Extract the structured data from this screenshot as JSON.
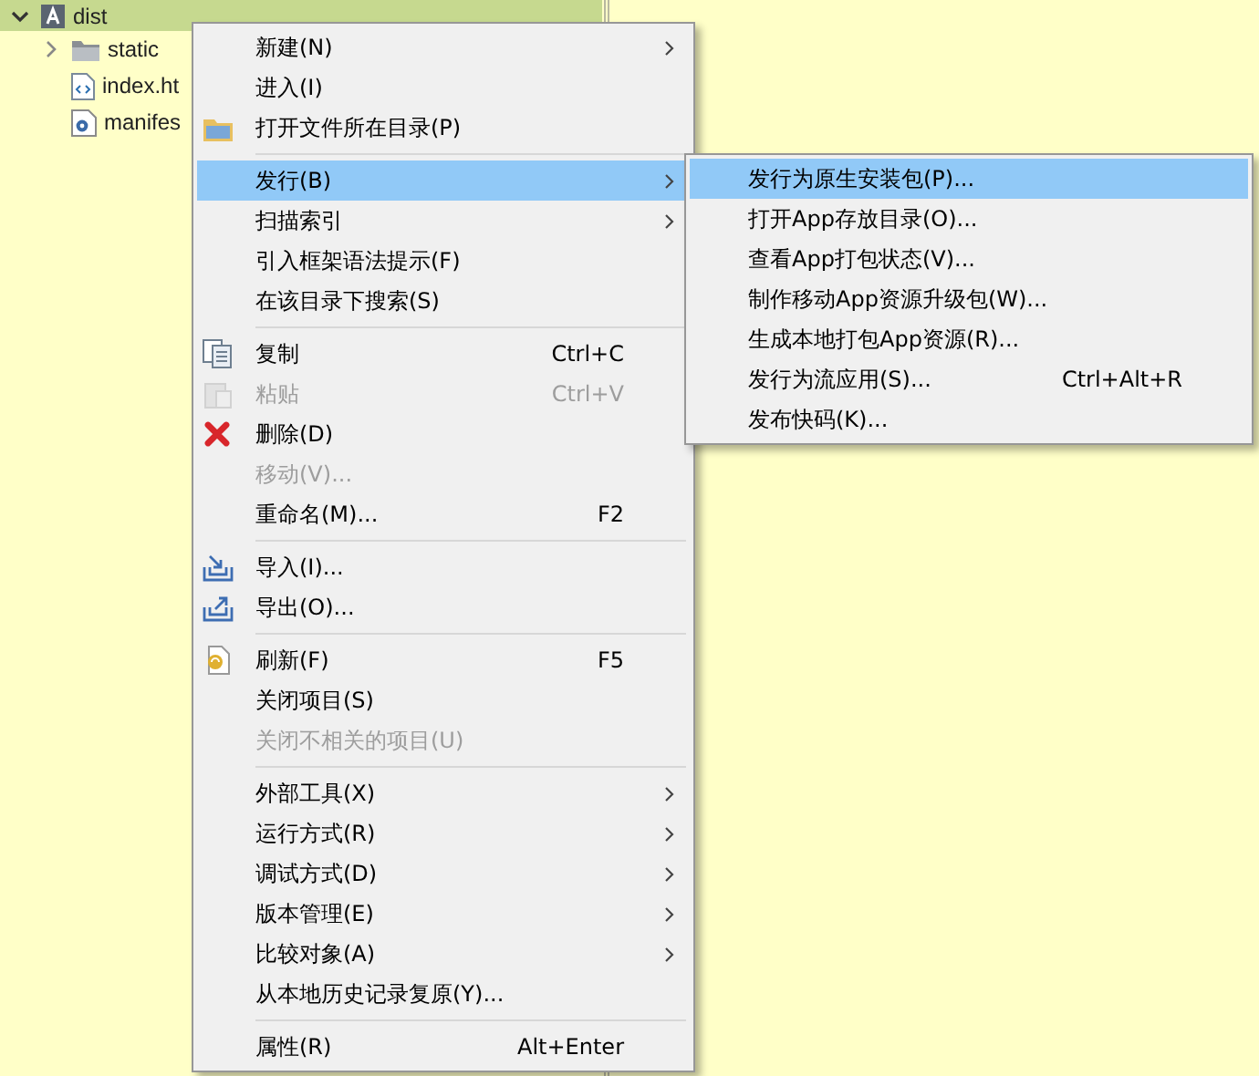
{
  "tree": [
    {
      "label": "dist",
      "kind": "project",
      "selected": true,
      "expanded": true,
      "children": [
        {
          "label": "static",
          "kind": "folder",
          "selected": false,
          "expanded": false
        },
        {
          "label": "index.ht",
          "kind": "html-file",
          "selected": false
        },
        {
          "label": "manifes",
          "kind": "config-file",
          "selected": false
        }
      ]
    }
  ],
  "context_menu": {
    "items": [
      {
        "kind": "item",
        "label": "新建(N)",
        "submenu": true,
        "selected": false,
        "disabled": false
      },
      {
        "kind": "item",
        "label": "进入(I)",
        "submenu": false,
        "selected": false,
        "disabled": false
      },
      {
        "kind": "item",
        "label": "打开文件所在目录(P)",
        "submenu": false,
        "selected": false,
        "disabled": false
      },
      {
        "kind": "separator"
      },
      {
        "kind": "item",
        "label": "发行(B)",
        "submenu": true,
        "selected": true,
        "disabled": false
      },
      {
        "kind": "item",
        "label": "扫描索引",
        "submenu": true,
        "selected": false,
        "disabled": false
      },
      {
        "kind": "item",
        "label": "引入框架语法提示(F)",
        "submenu": false,
        "selected": false,
        "disabled": false
      },
      {
        "kind": "item",
        "label": "在该目录下搜索(S)",
        "submenu": false,
        "selected": false,
        "disabled": false
      },
      {
        "kind": "separator"
      },
      {
        "kind": "item",
        "label": "复制",
        "shortcut": "Ctrl+C",
        "submenu": false,
        "selected": false,
        "disabled": false
      },
      {
        "kind": "item",
        "label": "粘贴",
        "shortcut": "Ctrl+V",
        "submenu": false,
        "selected": false,
        "disabled": true
      },
      {
        "kind": "item",
        "label": "删除(D)",
        "submenu": false,
        "selected": false,
        "disabled": false
      },
      {
        "kind": "item",
        "label": "移动(V)...",
        "submenu": false,
        "selected": false,
        "disabled": true
      },
      {
        "kind": "item",
        "label": "重命名(M)...",
        "shortcut": "F2",
        "submenu": false,
        "selected": false,
        "disabled": false
      },
      {
        "kind": "separator"
      },
      {
        "kind": "item",
        "label": "导入(I)...",
        "submenu": false,
        "selected": false,
        "disabled": false
      },
      {
        "kind": "item",
        "label": "导出(O)...",
        "submenu": false,
        "selected": false,
        "disabled": false
      },
      {
        "kind": "separator"
      },
      {
        "kind": "item",
        "label": "刷新(F)",
        "shortcut": "F5",
        "submenu": false,
        "selected": false,
        "disabled": false
      },
      {
        "kind": "item",
        "label": "关闭项目(S)",
        "submenu": false,
        "selected": false,
        "disabled": false
      },
      {
        "kind": "item",
        "label": "关闭不相关的项目(U)",
        "submenu": false,
        "selected": false,
        "disabled": true
      },
      {
        "kind": "separator"
      },
      {
        "kind": "item",
        "label": "外部工具(X)",
        "submenu": true,
        "selected": false,
        "disabled": false
      },
      {
        "kind": "item",
        "label": "运行方式(R)",
        "submenu": true,
        "selected": false,
        "disabled": false
      },
      {
        "kind": "item",
        "label": "调试方式(D)",
        "submenu": true,
        "selected": false,
        "disabled": false
      },
      {
        "kind": "item",
        "label": "版本管理(E)",
        "submenu": true,
        "selected": false,
        "disabled": false
      },
      {
        "kind": "item",
        "label": "比较对象(A)",
        "submenu": true,
        "selected": false,
        "disabled": false
      },
      {
        "kind": "item",
        "label": "从本地历史记录复原(Y)...",
        "submenu": false,
        "selected": false,
        "disabled": false
      },
      {
        "kind": "separator"
      },
      {
        "kind": "item",
        "label": "属性(R)",
        "shortcut": "Alt+Enter",
        "submenu": false,
        "selected": false,
        "disabled": false
      }
    ]
  },
  "submenu": {
    "items": [
      {
        "kind": "item",
        "label": "发行为原生安装包(P)...",
        "selected": true,
        "disabled": false
      },
      {
        "kind": "item",
        "label": "打开App存放目录(O)...",
        "selected": false,
        "disabled": false
      },
      {
        "kind": "item",
        "label": "查看App打包状态(V)...",
        "selected": false,
        "disabled": false
      },
      {
        "kind": "item",
        "label": "制作移动App资源升级包(W)...",
        "selected": false,
        "disabled": false
      },
      {
        "kind": "item",
        "label": "生成本地打包App资源(R)...",
        "selected": false,
        "disabled": false
      },
      {
        "kind": "item",
        "label": "发行为流应用(S)...",
        "shortcut": "Ctrl+Alt+R",
        "selected": false,
        "disabled": false
      },
      {
        "kind": "item",
        "label": "发布快码(K)...",
        "selected": false,
        "disabled": false
      }
    ]
  }
}
